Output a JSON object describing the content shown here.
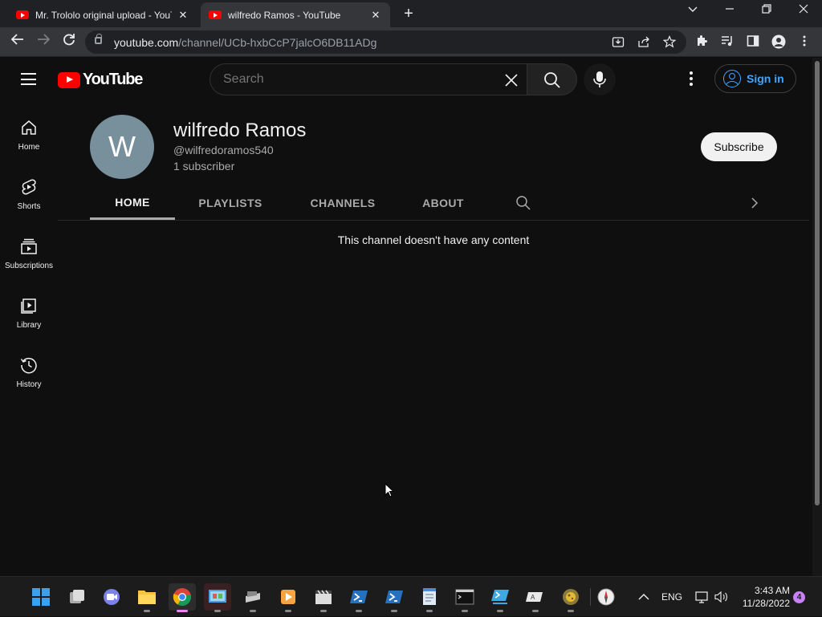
{
  "browser": {
    "tabs": [
      {
        "title": "Mr. Trololo original upload - YouT",
        "active": false
      },
      {
        "title": "wilfredo Ramos - YouTube",
        "active": true
      }
    ],
    "address": {
      "host": "youtube.com",
      "path": "/channel/UCb-hxbCcP7jalcO6DB11ADg"
    }
  },
  "youtube": {
    "logo_text": "YouTube",
    "search": {
      "query": "",
      "placeholder": "Search"
    },
    "signin_label": "Sign in",
    "guide": [
      {
        "label": "Home",
        "icon": "home-icon"
      },
      {
        "label": "Shorts",
        "icon": "shorts-icon"
      },
      {
        "label": "Subscriptions",
        "icon": "subscriptions-icon"
      },
      {
        "label": "Library",
        "icon": "library-icon"
      },
      {
        "label": "History",
        "icon": "history-icon"
      }
    ]
  },
  "channel": {
    "avatar_letter": "W",
    "avatar_color": "#78909c",
    "name": "wilfredo Ramos",
    "handle": "@wilfredoramos540",
    "subscribers": "1 subscriber",
    "subscribe_label": "Subscribe",
    "tabs": [
      {
        "label": "HOME",
        "active": true
      },
      {
        "label": "PLAYLISTS",
        "active": false
      },
      {
        "label": "CHANNELS",
        "active": false
      },
      {
        "label": "ABOUT",
        "active": false
      }
    ],
    "empty_message": "This channel doesn't have any content"
  },
  "taskbar": {
    "apps": [
      "start-icon",
      "task-view-icon",
      "teams-icon",
      "file-explorer-icon",
      "chrome-icon",
      "control-panel-icon",
      "scanner-icon",
      "media-player-icon",
      "clapperboard-icon",
      "powershell-icon",
      "powershell-icon",
      "notepad-icon",
      "terminal-icon",
      "powershell-ise-icon",
      "remote-icon",
      "cheese-icon",
      "compass-icon"
    ],
    "language": "ENG",
    "time": "3:43 AM",
    "date": "11/28/2022",
    "notifications": "4"
  },
  "colors": {
    "accent_blue": "#3ea6ff",
    "yt_red": "#ff0000",
    "bg": "#0f0f0f"
  }
}
